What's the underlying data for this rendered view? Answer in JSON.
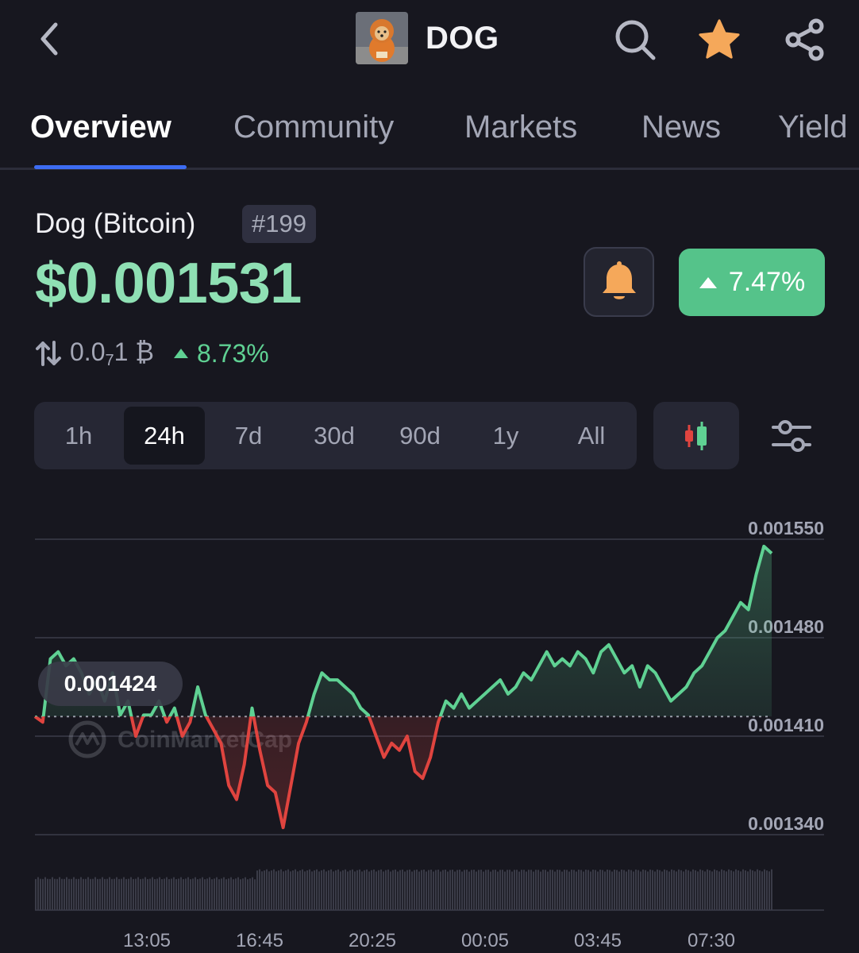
{
  "header": {
    "title": "DOG",
    "icons": [
      "back-chevron-icon",
      "search-icon",
      "star-icon",
      "share-icon"
    ],
    "star_color": "#f5a85a"
  },
  "tabs": [
    {
      "label": "Overview",
      "active": true
    },
    {
      "label": "Community",
      "active": false
    },
    {
      "label": "Markets",
      "active": false
    },
    {
      "label": "News",
      "active": false
    },
    {
      "label": "Yield",
      "active": false
    }
  ],
  "coin": {
    "name": "Dog (Bitcoin)",
    "rank": "#199",
    "price": "$0.001531",
    "change_24h": "7.47%",
    "btc_price_lead": "0.0",
    "btc_price_sub": "7",
    "btc_price_tail": "1 ₿",
    "btc_change": "8.73%"
  },
  "ranges": [
    {
      "label": "1h",
      "active": false
    },
    {
      "label": "24h",
      "active": true
    },
    {
      "label": "7d",
      "active": false
    },
    {
      "label": "30d",
      "active": false
    },
    {
      "label": "90d",
      "active": false
    },
    {
      "label": "1y",
      "active": false
    },
    {
      "label": "All",
      "active": false
    }
  ],
  "colors": {
    "up": "#5fd193",
    "down": "#e0443f",
    "accent": "#3d6cf2",
    "badge_up": "#55c38a",
    "price": "#8fe0b4"
  },
  "chart_data": {
    "type": "line",
    "watermark": "CoinMarketCap",
    "reference_label": "0.001424",
    "reference_value": 0.001424,
    "y_ticks": [
      "0.001550",
      "0.001480",
      "0.001410",
      "0.001340"
    ],
    "ylim": [
      0.00134,
      0.00155
    ],
    "x_ticks": [
      "13:05",
      "16:45",
      "20:25",
      "00:05",
      "03:45",
      "07:30"
    ],
    "series": [
      {
        "values": [
          0.001424,
          0.00142,
          0.001465,
          0.00147,
          0.00146,
          0.001465,
          0.001455,
          0.00144,
          0.00145,
          0.001435,
          0.001455,
          0.001425,
          0.001435,
          0.00141,
          0.001425,
          0.001425,
          0.001435,
          0.00142,
          0.00143,
          0.00141,
          0.00142,
          0.001445,
          0.001425,
          0.001415,
          0.001405,
          0.001375,
          0.001365,
          0.00139,
          0.00143,
          0.0014,
          0.001375,
          0.00137,
          0.001345,
          0.001375,
          0.001405,
          0.00142,
          0.00144,
          0.001455,
          0.00145,
          0.00145,
          0.001445,
          0.00144,
          0.00143,
          0.001425,
          0.00141,
          0.001395,
          0.001405,
          0.0014,
          0.00141,
          0.001385,
          0.00138,
          0.001395,
          0.00142,
          0.001435,
          0.00143,
          0.00144,
          0.00143,
          0.001435,
          0.00144,
          0.001445,
          0.00145,
          0.00144,
          0.001445,
          0.001455,
          0.00145,
          0.00146,
          0.00147,
          0.00146,
          0.001465,
          0.00146,
          0.00147,
          0.001465,
          0.001455,
          0.00147,
          0.001475,
          0.001465,
          0.001455,
          0.00146,
          0.001445,
          0.00146,
          0.001455,
          0.001445,
          0.001435,
          0.00144,
          0.001445,
          0.001455,
          0.00146,
          0.00147,
          0.00148,
          0.001485,
          0.001495,
          0.001505,
          0.0015,
          0.001525,
          0.001545,
          0.00154
        ]
      }
    ],
    "volume_bars": true,
    "grid": true
  }
}
